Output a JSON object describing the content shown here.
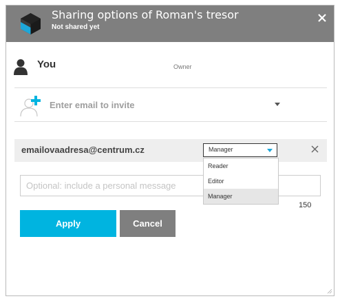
{
  "header": {
    "title": "Sharing options of Roman's tresor",
    "subtitle": "Not shared yet",
    "close_icon": "close-icon",
    "logo_icon": "tresor-logo-icon",
    "background_color": "#7f7f7f"
  },
  "owner": {
    "name": "You",
    "role": "Owner",
    "icon": "person-icon"
  },
  "invite": {
    "placeholder": "Enter email to invite",
    "icon": "add-user-icon",
    "accent_color": "#00b4e0"
  },
  "member": {
    "email": "emailovaadresa@centrum.cz",
    "selected_role": "Manager",
    "remove_icon": "close-icon"
  },
  "role_options": [
    {
      "label": "Reader"
    },
    {
      "label": "Editor"
    },
    {
      "label": "Manager"
    }
  ],
  "message": {
    "placeholder": "Optional: include a personal message",
    "char_limit": "150"
  },
  "buttons": {
    "apply": "Apply",
    "cancel": "Cancel",
    "apply_color": "#00b4e0",
    "cancel_color": "#7f7f7f"
  }
}
